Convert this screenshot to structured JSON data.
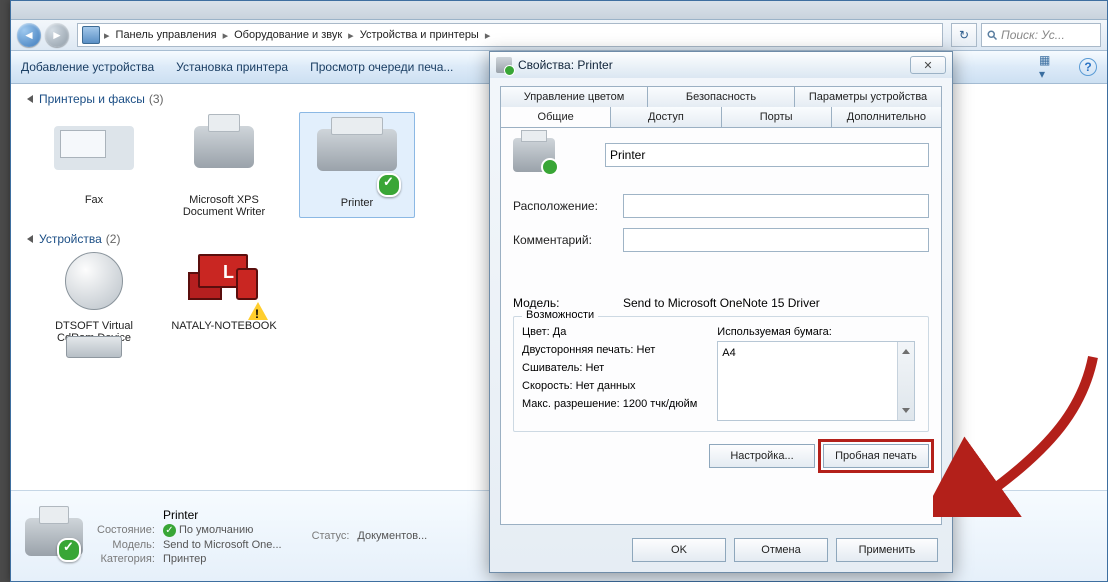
{
  "breadcrumb": [
    "Панель управления",
    "Оборудование и звук",
    "Устройства и принтеры"
  ],
  "search_placeholder": "Поиск: Ус...",
  "toolbar": {
    "add_device": "Добавление устройства",
    "add_printer": "Установка принтера",
    "view_queue": "Просмотр очереди печа..."
  },
  "groups": {
    "printers": {
      "title": "Принтеры и факсы",
      "count": "(3)"
    },
    "devices": {
      "title": "Устройства",
      "count": "(2)"
    }
  },
  "items": {
    "fax": "Fax",
    "xps": "Microsoft XPS Document Writer",
    "printer": "Printer",
    "cdrom": "DTSOFT Virtual CdRom Device",
    "laptop": "NATALY-NOTEBOOK"
  },
  "details": {
    "name": "Printer",
    "state_k": "Состояние:",
    "state_v": "По умолчанию",
    "model_k": "Модель:",
    "model_v": "Send to Microsoft One...",
    "category_k": "Категория:",
    "category_v": "Принтер",
    "status_k": "Статус:",
    "status_v": "Документов..."
  },
  "dialog": {
    "title": "Свойства: Printer",
    "tabs_top": [
      "Управление цветом",
      "Безопасность",
      "Параметры устройства"
    ],
    "tabs_bottom": [
      "Общие",
      "Доступ",
      "Порты",
      "Дополнительно"
    ],
    "name_value": "Printer",
    "location_label": "Расположение:",
    "comment_label": "Комментарий:",
    "model_label": "Модель:",
    "model_value": "Send to Microsoft OneNote 15 Driver",
    "caps_legend": "Возможности",
    "caps": {
      "color": "Цвет: Да",
      "duplex": "Двусторонняя печать: Нет",
      "staple": "Сшиватель: Нет",
      "speed": "Скорость: Нет данных",
      "maxres": "Макс. разрешение: 1200 тчк/дюйм"
    },
    "paper_label": "Используемая бумага:",
    "paper_value": "A4",
    "prefs_btn": "Настройка...",
    "test_btn": "Пробная печать",
    "ok": "OK",
    "cancel": "Отмена",
    "apply": "Применить"
  }
}
